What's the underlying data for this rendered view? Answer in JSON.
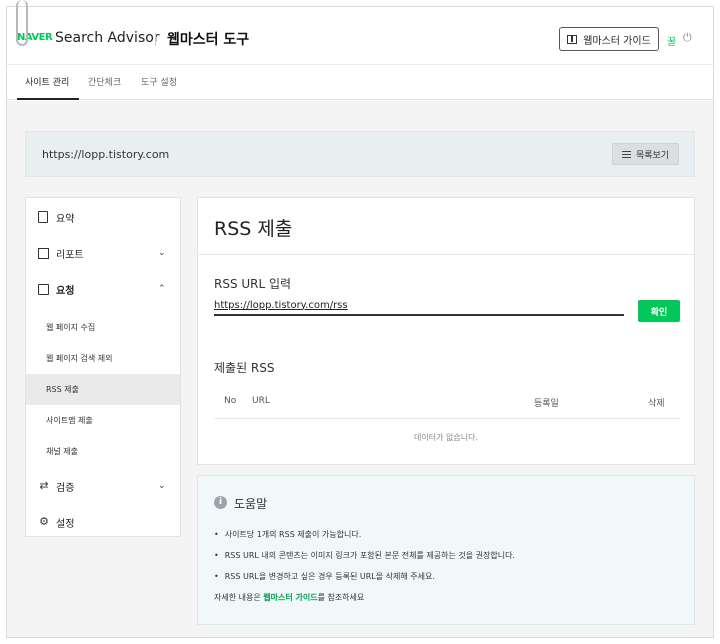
{
  "header": {
    "logo": "NAVER",
    "brand": "Search Advisor",
    "tool_title": "웹마스터 도구",
    "guide_button": "웹마스터 가이드",
    "user": "꿀",
    "power_icon": "power-icon"
  },
  "tabs": [
    {
      "label": "사이트 관리",
      "active": true
    },
    {
      "label": "간단체크",
      "active": false
    },
    {
      "label": "도구 설정",
      "active": false
    }
  ],
  "site": {
    "url": "https://lopp.tistory.com",
    "list_button": "목록보기"
  },
  "sidebar": {
    "items": [
      {
        "label": "요약",
        "icon": "document-icon"
      },
      {
        "label": "리포트",
        "icon": "chart-icon"
      },
      {
        "label": "요청",
        "icon": "checkbox-icon"
      },
      {
        "label": "검증",
        "icon": "repeat-icon"
      },
      {
        "label": "설정",
        "icon": "gear-icon"
      }
    ],
    "sub_items": [
      {
        "label": "웹 페이지 수집",
        "active": false
      },
      {
        "label": "웹 페이지 검색 제외",
        "active": false
      },
      {
        "label": "RSS 제출",
        "active": true
      },
      {
        "label": "사이트맵 제출",
        "active": false
      },
      {
        "label": "채널 제출",
        "active": false
      }
    ]
  },
  "main": {
    "title": "RSS 제출",
    "input_section": "RSS URL 입력",
    "input_value": "https://lopp.tistory.com/rss",
    "confirm_button": "확인",
    "submitted_title": "제출된 RSS",
    "columns": [
      "No",
      "URL",
      "등록일",
      "삭제"
    ],
    "empty_text": "데이터가 없습니다."
  },
  "help": {
    "title": "도움말",
    "bullets": [
      "사이트당 1개의 RSS 제출이 가능합니다.",
      "RSS URL 내의 콘텐츠는 이미지 링크가 포함된 본문 전체를 제공하는 것을 권장합니다.",
      "RSS URL을 변경하고 싶은 경우 등록된 URL을 삭제해 주세요."
    ],
    "footer_pre": "자세한 내용은 ",
    "footer_link": "웹마스터 가이드",
    "footer_post": "를 참조하세요"
  },
  "colors": {
    "accent": "#03c75a",
    "background": "#f4f4f4",
    "help_bg": "#f1f8f9"
  }
}
